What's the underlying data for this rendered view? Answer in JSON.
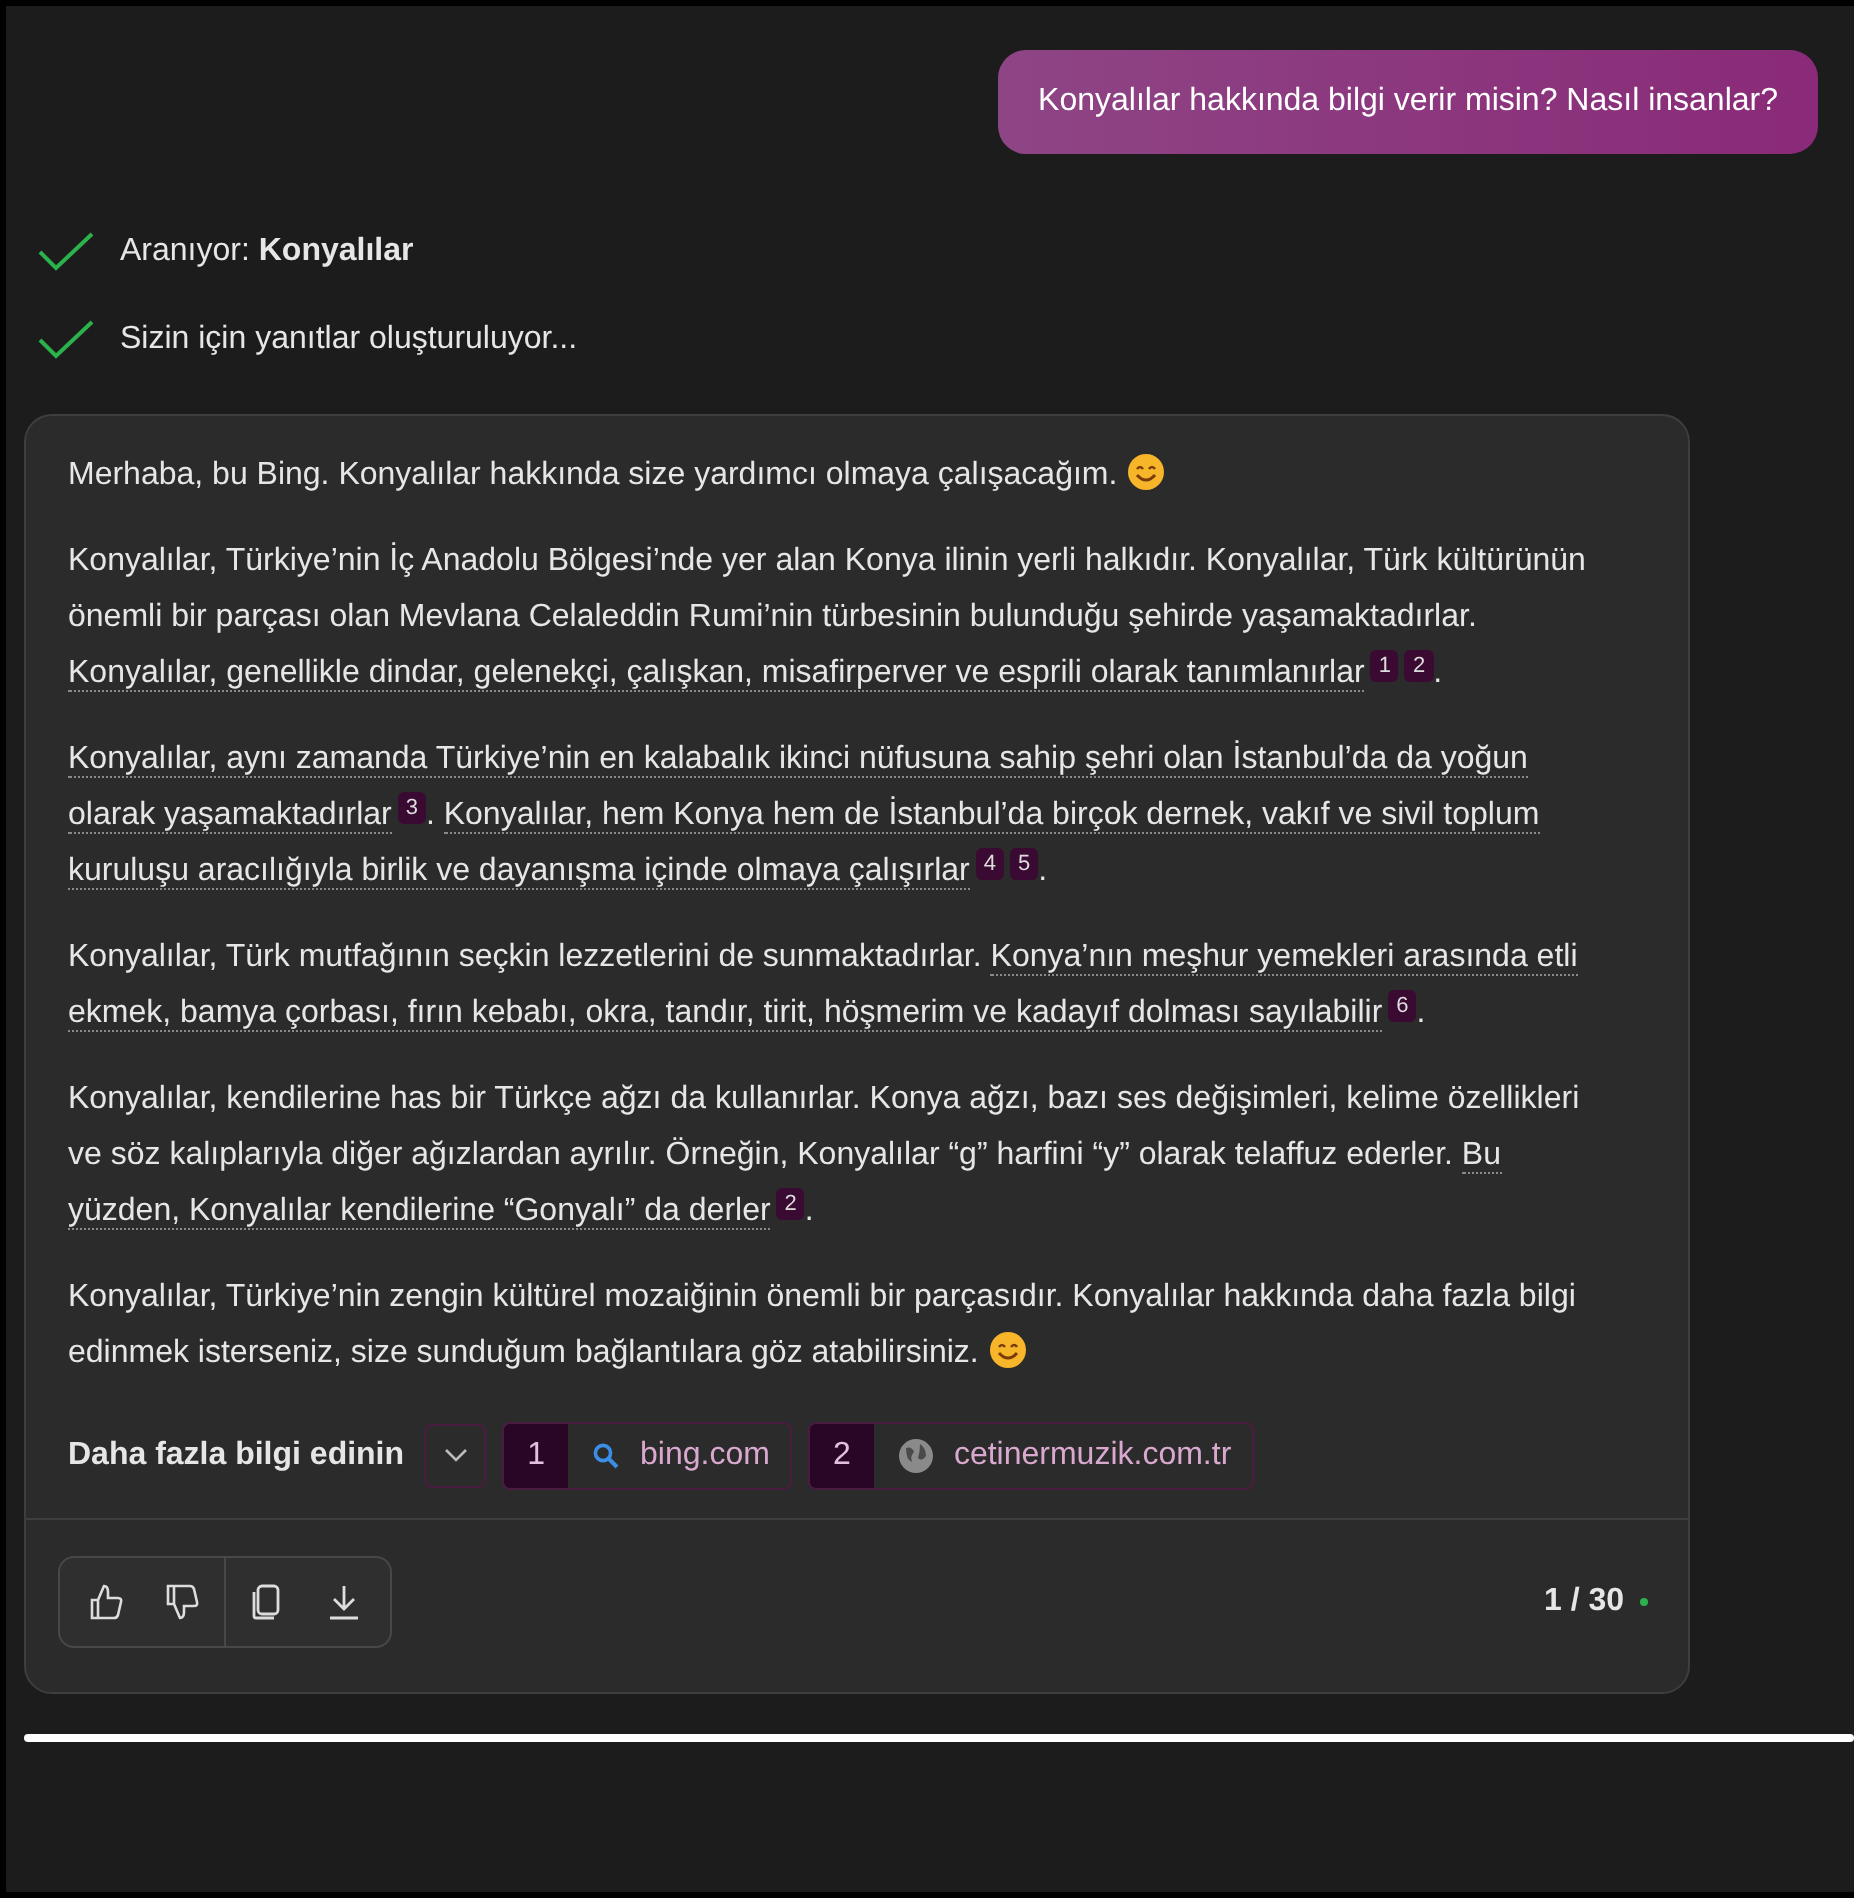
{
  "user_message": "Konyalılar hakkında bilgi verir misin? Nasıl insanlar?",
  "progress": [
    {
      "text": "Aranıyor: **Konyalılar**",
      "done": true
    },
    {
      "text": "Sizin için yanıtlar oluşturuluyor...",
      "done": true
    }
  ],
  "answer": {
    "paragraphs": [
      [
        {
          "kind": "text",
          "text": "Merhaba, bu Bing. Konyalılar hakkında size yardımcı olmaya çalışacağım. ",
          "cited": false
        },
        {
          "kind": "emoji"
        }
      ],
      [
        {
          "kind": "text",
          "text": "Konyalılar, Türkiye’nin İç Anadolu Bölgesi’nde yer alan Konya ilinin yerli halkıdır. Konyalılar, Türk kültürünün önemli bir parçası olan Mevlana Celaleddin Rumi’nin türbesinin bulunduğu şehirde yaşamaktadırlar. ",
          "cited": false
        },
        {
          "kind": "text",
          "text": "Konyalılar, genellikle dindar, gelenekçi, çalışkan, misafirperver ve esprili olarak tanımlanırlar",
          "cited": true
        },
        {
          "kind": "cite",
          "label": "1"
        },
        {
          "kind": "cite",
          "label": "2"
        },
        {
          "kind": "text",
          "text": ".",
          "cited": false
        }
      ],
      [
        {
          "kind": "text",
          "text": "Konyalılar, aynı zamanda Türkiye’nin en kalabalık ikinci nüfusuna sahip şehri olan İstanbul’da da yoğun olarak yaşamaktadırlar",
          "cited": true
        },
        {
          "kind": "cite",
          "label": "3"
        },
        {
          "kind": "text",
          "text": ". ",
          "cited": false
        },
        {
          "kind": "text",
          "text": "Konyalılar, hem Konya hem de İstanbul’da birçok dernek, vakıf ve sivil toplum kuruluşu aracılığıyla birlik ve dayanışma içinde olmaya çalışırlar",
          "cited": true
        },
        {
          "kind": "cite",
          "label": "4"
        },
        {
          "kind": "cite",
          "label": "5"
        },
        {
          "kind": "text",
          "text": ".",
          "cited": false
        }
      ],
      [
        {
          "kind": "text",
          "text": "Konyalılar, Türk mutfağının seçkin lezzetlerini de sunmaktadırlar. ",
          "cited": false
        },
        {
          "kind": "text",
          "text": "Konya’nın meşhur yemekleri arasında etli ekmek, bamya çorbası, fırın kebabı, okra, tandır, tirit, höşmerim ve kadayıf dolması sayılabilir",
          "cited": true
        },
        {
          "kind": "cite",
          "label": "6"
        },
        {
          "kind": "text",
          "text": ".",
          "cited": false
        }
      ],
      [
        {
          "kind": "text",
          "text": "Konyalılar, kendilerine has bir Türkçe ağzı da kullanırlar. Konya ağzı, bazı ses değişimleri, kelime özellikleri ve söz kalıplarıyla diğer ağızlardan ayrılır. Örneğin, Konyalılar “g” harfini “y” olarak telaffuz ederler. ",
          "cited": false
        },
        {
          "kind": "text",
          "text": "Bu yüzden, Konyalılar kendilerine “Gonyalı” da derler",
          "cited": true
        },
        {
          "kind": "cite",
          "label": "2"
        },
        {
          "kind": "text",
          "text": ".",
          "cited": false
        }
      ],
      [
        {
          "kind": "text",
          "text": "Konyalılar, Türkiye’nin zengin kültürel mozaiğinin önemli bir parçasıdır. Konyalılar hakkında daha fazla bilgi edinmek isterseniz, size sunduğum bağlantılara göz atabilirsiniz. ",
          "cited": false
        },
        {
          "kind": "emoji"
        }
      ]
    ],
    "learn_more": {
      "label": "Daha fazla bilgi edinin",
      "sources": [
        {
          "number": "1",
          "site": "bing.com",
          "kind": "search"
        },
        {
          "number": "2",
          "site": "cetinermuzik.com.tr",
          "kind": "globe"
        }
      ]
    },
    "counter": "1 / 30"
  }
}
